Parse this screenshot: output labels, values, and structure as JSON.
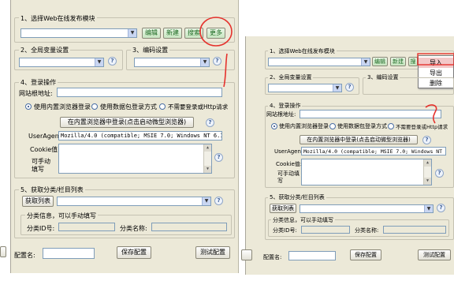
{
  "left": {
    "sec1": {
      "title": "1、选择Web在线发布模块",
      "buttons": {
        "edit": "编辑",
        "new": "新建",
        "search": "搜索",
        "more": "更多"
      }
    },
    "sec2": {
      "title": "2、全局变量设置"
    },
    "sec3": {
      "title": "3、编码设置"
    },
    "sec4": {
      "title": "4、登录操作",
      "site_label": "网站根地址:",
      "radio_builtin": "使用内置浏览器登录",
      "radio_packet": "使用数据包登录方式",
      "radio_none": "不需要登录或Http请求",
      "browser_login_button": "在内置浏览器中登录(点击启动微型浏览器)",
      "useragent_label": "UserAgent",
      "useragent_value": "Mozilla/4.0 (compatible; MSIE 7.0; Windows NT 6.1;",
      "cookie_label": "Cookie值:",
      "cookie_hint": "可手动填写"
    },
    "sec5": {
      "title": "5、获取分类/栏目列表",
      "get_list_button": "获取列表",
      "cat_info_title": "分类信息，可以手动填写",
      "cat_id_label": "分类ID号:",
      "cat_name_label": "分类名称:"
    },
    "bottom": {
      "config_label": "配置名:",
      "save_button": "保存配置",
      "test_button": "测试配置"
    }
  },
  "right": {
    "sec1": {
      "title": "1、选择Web在线发布模块",
      "buttons": {
        "edit": "编辑",
        "new": "新建",
        "search": "搜"
      }
    },
    "menu": [
      "导入",
      "导出",
      "删除"
    ],
    "sec2": {
      "title": "2、全局变量设置"
    },
    "sec3": {
      "title": "3、编码设置"
    },
    "sec4": {
      "title": "4、登录操作",
      "site_label": "网站根地址:",
      "radio_builtin": "使用内置浏览器登录",
      "radio_packet": "使用数据包登录方式",
      "radio_none": "不需要登录或Http请求",
      "browser_login_button": "在内置浏览器中登录(点击启动微型浏览器)",
      "useragent_label": "UserAgent",
      "useragent_value": "Mozilla/4.0 (compatible; MSIE 7.0; Windows NT 6.1;",
      "cookie_label": "Cookie值:",
      "cookie_hint": "可手动填写"
    },
    "sec5": {
      "title": "5、获取分类/栏目列表",
      "get_list_button": "获取列表",
      "cat_info_title": "分类信息，可以手动填写",
      "cat_id_label": "分类ID号:",
      "cat_name_label": "分类名称:"
    },
    "bottom": {
      "config_label": "配置名:",
      "save_button": "保存配置",
      "test_button": "测试配置"
    }
  },
  "help_glyph": "?",
  "annotation_color": "#e5322d"
}
